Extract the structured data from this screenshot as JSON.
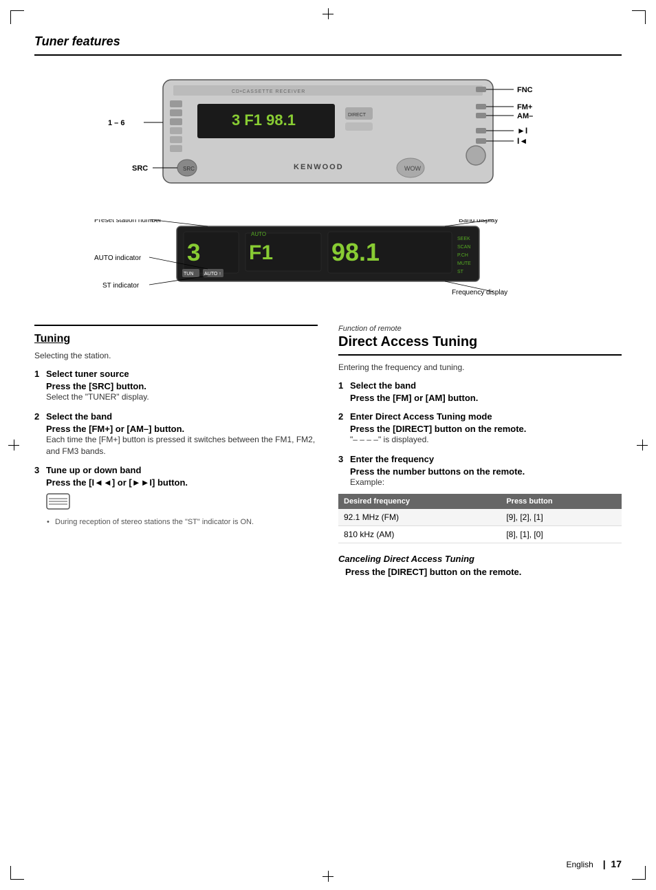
{
  "page": {
    "title": "Tuner features",
    "page_number": "17",
    "language_label": "English"
  },
  "device_labels": {
    "fnc": "FNC",
    "fm_plus": "FM+",
    "am_minus": "AM–",
    "fwd": "►I",
    "rwd": "I◄",
    "src": "SRC",
    "preset": "1 – 6",
    "brand": "KENWOOD"
  },
  "display_labels": {
    "preset_station_number": "Preset station number",
    "auto_indicator": "AUTO indicator",
    "st_indicator": "ST indicator",
    "band_display": "Band display",
    "frequency_display": "Frequency display",
    "screen_text": "3  F1  98.1"
  },
  "tuning_section": {
    "title": "Tuning",
    "description": "Selecting the station.",
    "steps": [
      {
        "number": "1",
        "title": "Select tuner source",
        "action": "Press the [SRC] button.",
        "description": "Select the \"TUNER\" display."
      },
      {
        "number": "2",
        "title": "Select the band",
        "action": "Press the [FM+] or [AM–] button.",
        "description": "Each time the [FM+] button is pressed it switches between the FM1, FM2, and FM3 bands."
      },
      {
        "number": "3",
        "title": "Tune up or down band",
        "action": "Press the [I◄◄] or [►►I] button.",
        "description": ""
      }
    ],
    "note": "During reception of stereo stations the \"ST\" indicator is ON."
  },
  "direct_access_section": {
    "function_label": "Function of remote",
    "title": "Direct Access Tuning",
    "description": "Entering the frequency and tuning.",
    "steps": [
      {
        "number": "1",
        "title": "Select the band",
        "action": "Press the [FM] or [AM] button.",
        "description": ""
      },
      {
        "number": "2",
        "title": "Enter Direct Access Tuning mode",
        "action": "Press the [DIRECT] button on the remote.",
        "description": "\"– – – –\" is displayed."
      },
      {
        "number": "3",
        "title": "Enter the frequency",
        "action": "Press the number buttons on the remote.",
        "description": "Example:"
      }
    ],
    "table": {
      "headers": [
        "Desired frequency",
        "Press button"
      ],
      "rows": [
        [
          "92.1 MHz (FM)",
          "[9], [2], [1]"
        ],
        [
          "810 kHz (AM)",
          "[8], [1], [0]"
        ]
      ]
    },
    "cancel_section": {
      "title": "Canceling Direct Access Tuning",
      "action": "Press the [DIRECT] button on the remote."
    }
  }
}
